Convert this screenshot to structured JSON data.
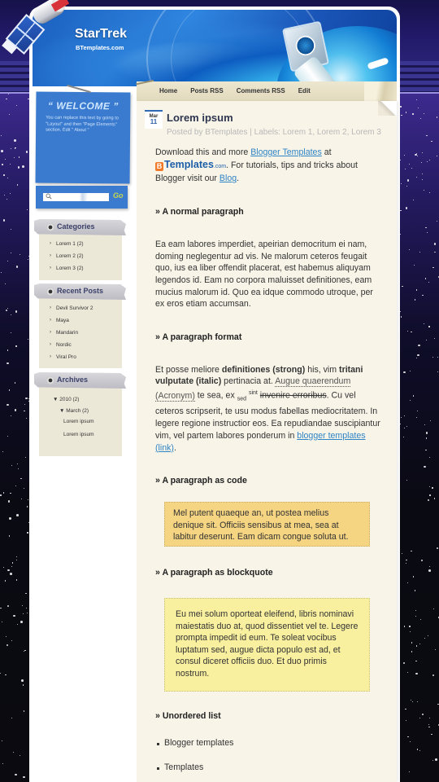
{
  "site": {
    "title": "StarTrek",
    "description": "BTemplates.com"
  },
  "nav": {
    "items": [
      "Home",
      "Posts RSS",
      "Comments RSS",
      "Edit"
    ]
  },
  "sidebar": {
    "welcome": {
      "title": "“ WELCOME ”",
      "text": "You can replace this text by going to \"Layout\" and then \"Page Elements\" section. Edit \" About \""
    },
    "search": {
      "placeholder": "",
      "button_label": "Go"
    },
    "categories": {
      "title": "Categories",
      "items": [
        "Lorem 1 (2)",
        "Lorem 2 (2)",
        "Lorem 3 (2)"
      ]
    },
    "recent_posts": {
      "title": "Recent Posts",
      "items": [
        "Devil Survivor 2",
        "Maya",
        "Mandarin",
        "Nordic",
        "Viral Pro"
      ]
    },
    "archives": {
      "title": "Archives",
      "year": "▼ 2010 (2)",
      "month": "▼ March (2)",
      "posts": [
        "Lorem ipsum",
        "Lorem ipsum"
      ]
    }
  },
  "post": {
    "date_month": "Mar",
    "date_day": "11",
    "title": "Lorem ipsum",
    "meta": "Posted by BTemplates | Labels: Lorem 1, Lorem 2, Lorem 3",
    "intro": {
      "text1": "Download this and more ",
      "link1": "Blogger Templates",
      "text2": " at ",
      "logo_b": "B",
      "logo_main": "Templates",
      "logo_com": ".com",
      "text3": ". For tutorials, tips and tricks about Blogger visit our ",
      "link2": "Blog",
      "text4": "."
    },
    "sections": {
      "normal_heading": "» A normal paragraph",
      "normal_text": "Ea eam labores imperdiet, apeirian democritum ei nam, doming neglegentur ad vis. Ne malorum ceteros feugait quo, ius ea liber offendit placerat, est habemus aliquyam legendos id. Eam no corpora maluisset definitiones, eam mucius malorum id. Quo ea idque commodo utroque, per ex eros etiam accumsan.",
      "format_heading": "» A paragraph format",
      "format": {
        "t1": "Et posse meliore ",
        "strong": "definitiones (strong)",
        "t2": " his, vim ",
        "italic": "tritani vulputate (italic)",
        "t3": " pertinacia at. ",
        "acronym": "Augue quaerendum (Acronym)",
        "t4": " te sea, ex ",
        "sub": "sed",
        "sup": "sint",
        "strike": "invenire erroribus",
        "t5": ". Cu vel ceteros scripserit, te usu modus fabellas mediocritatem. In legere regione instructior eos. Ea repudiandae suscipiantur vim, vel partem labores ponderum in ",
        "link": "blogger templates (link)",
        "t6": "."
      },
      "code_heading": "» A paragraph as code",
      "code_text": "Mel putent quaeque an, ut postea melius denique sit. Officiis sensibus at mea, sea at labitur deserunt. Eam dicam congue soluta ut.",
      "quote_heading": "» A paragraph as blockquote",
      "quote_text": "Eu mei solum oporteat eleifend, libris nominavi maiestatis duo at, quod dissentiet vel te. Legere prompta impedit id eum. Te soleat vocibus luptatum sed, augue dicta populo est ad, et consul diceret officiis duo. Et duo primis nostrum.",
      "list_heading": "» Unordered list",
      "list_items": [
        "Blogger templates",
        "Templates"
      ]
    }
  },
  "colors": {
    "accent_blue": "#3a7bd0",
    "link": "#2f84c6",
    "content_bg": "#f8f4e8",
    "code_bg": "#f5d482",
    "quote_bg": "#f8ef9f"
  }
}
